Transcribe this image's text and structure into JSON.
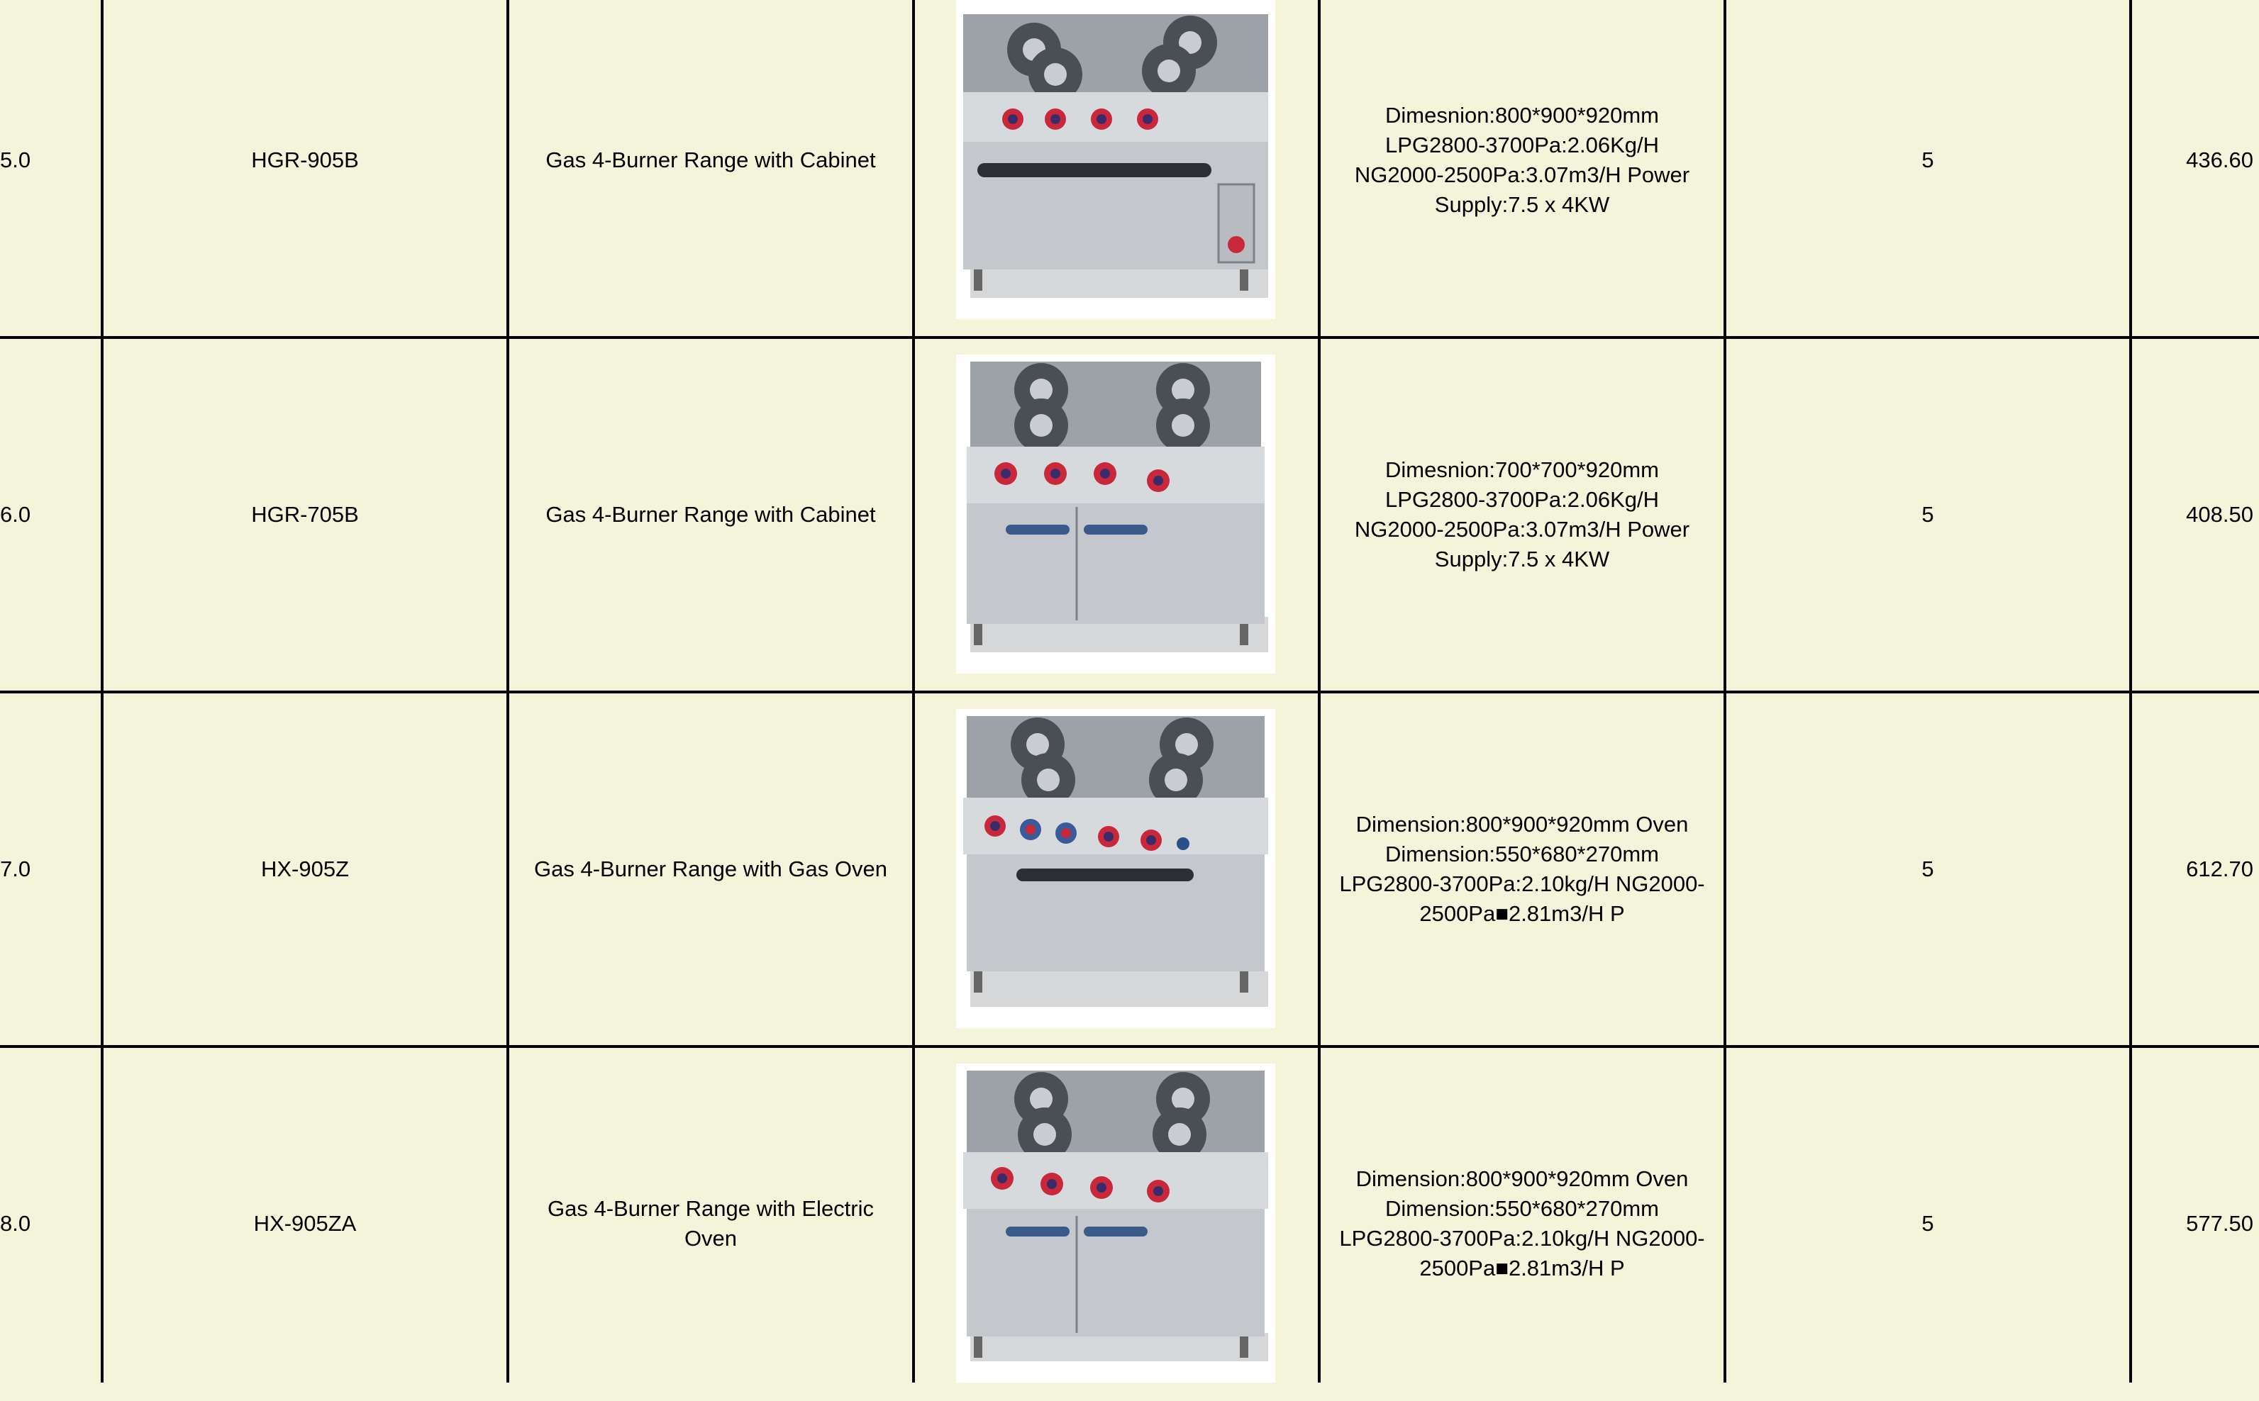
{
  "rows": [
    {
      "no": "5.0",
      "model": "HGR-905B",
      "description": "Gas 4-Burner Range with Cabinet",
      "image": "gas-range-oven-door-icon",
      "spec": "Dimesnion:800*900*920mm LPG2800-3700Pa:2.06Kg/H NG2000-2500Pa:3.07m3/H Power Supply:7.5 x 4KW",
      "qty": "5",
      "price": "436.60"
    },
    {
      "no": "6.0",
      "model": "HGR-705B",
      "description": "Gas 4-Burner Range with Cabinet",
      "image": "gas-range-cabinet-icon",
      "spec": "Dimesnion:700*700*920mm LPG2800-3700Pa:2.06Kg/H NG2000-2500Pa:3.07m3/H Power Supply:7.5 x 4KW",
      "qty": "5",
      "price": "408.50"
    },
    {
      "no": "7.0",
      "model": "HX-905Z",
      "description": "Gas 4-Burner Range with Gas Oven",
      "image": "gas-range-gas-oven-icon",
      "spec": "Dimension:800*900*920mm Oven Dimension:550*680*270mm LPG2800-3700Pa:2.10kg/H NG2000-2500Pa■2.81m3/H P",
      "qty": "5",
      "price": "612.70"
    },
    {
      "no": "8.0",
      "model": "HX-905ZA",
      "description": "Gas 4-Burner Range with Electric Oven",
      "image": "gas-range-electric-oven-icon",
      "spec": "Dimension:800*900*920mm Oven Dimension:550*680*270mm LPG2800-3700Pa:2.10kg/H NG2000-2500Pa■2.81m3/H P",
      "qty": "5",
      "price": "577.50"
    }
  ],
  "colors": {
    "background": "#f4f4da",
    "grid": "#000000",
    "knob": "#c8283a",
    "steel": "#cfd3d8"
  }
}
